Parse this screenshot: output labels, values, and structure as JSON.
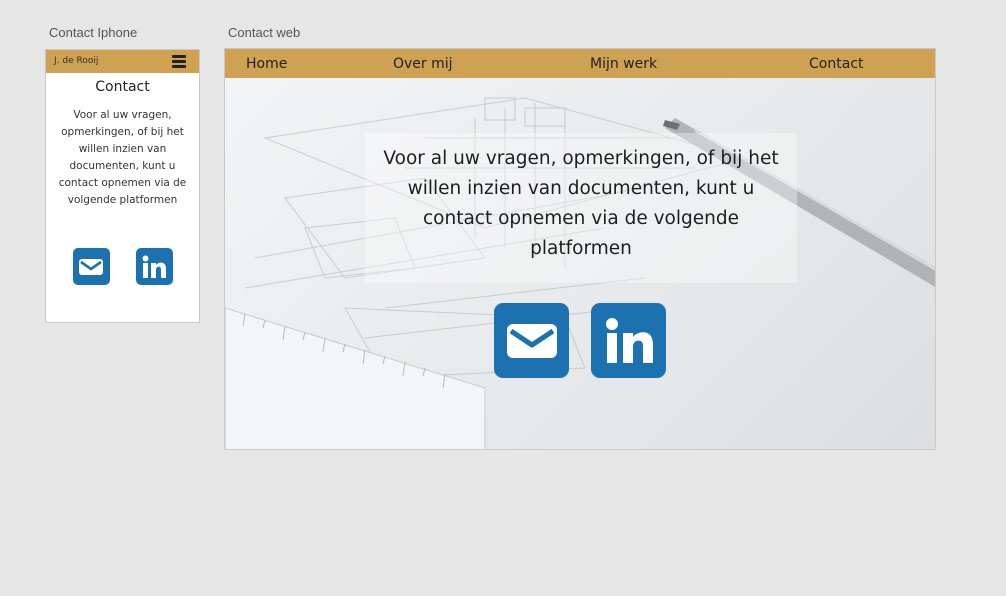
{
  "labels": {
    "phone": "Contact Iphone",
    "web": "Contact web"
  },
  "phone": {
    "brand": "J. de Rooij",
    "title": "Contact",
    "text": "Voor al uw vragen, opmerkingen, of bij het willen inzien van documenten, kunt u contact opnemen via de volgende platformen"
  },
  "web": {
    "nav": [
      "Home",
      "Over mij",
      "Mijn werk",
      "Contact"
    ],
    "text": "Voor al uw vragen, opmerkingen, of bij het willen inzien van documenten, kunt u contact opnemen via de volgende platformen"
  },
  "icons": [
    "envelope-icon",
    "linkedin-icon"
  ],
  "colors": {
    "accent": "#cfa153",
    "icon": "#1c72b0",
    "background": "#e6e6e6"
  }
}
